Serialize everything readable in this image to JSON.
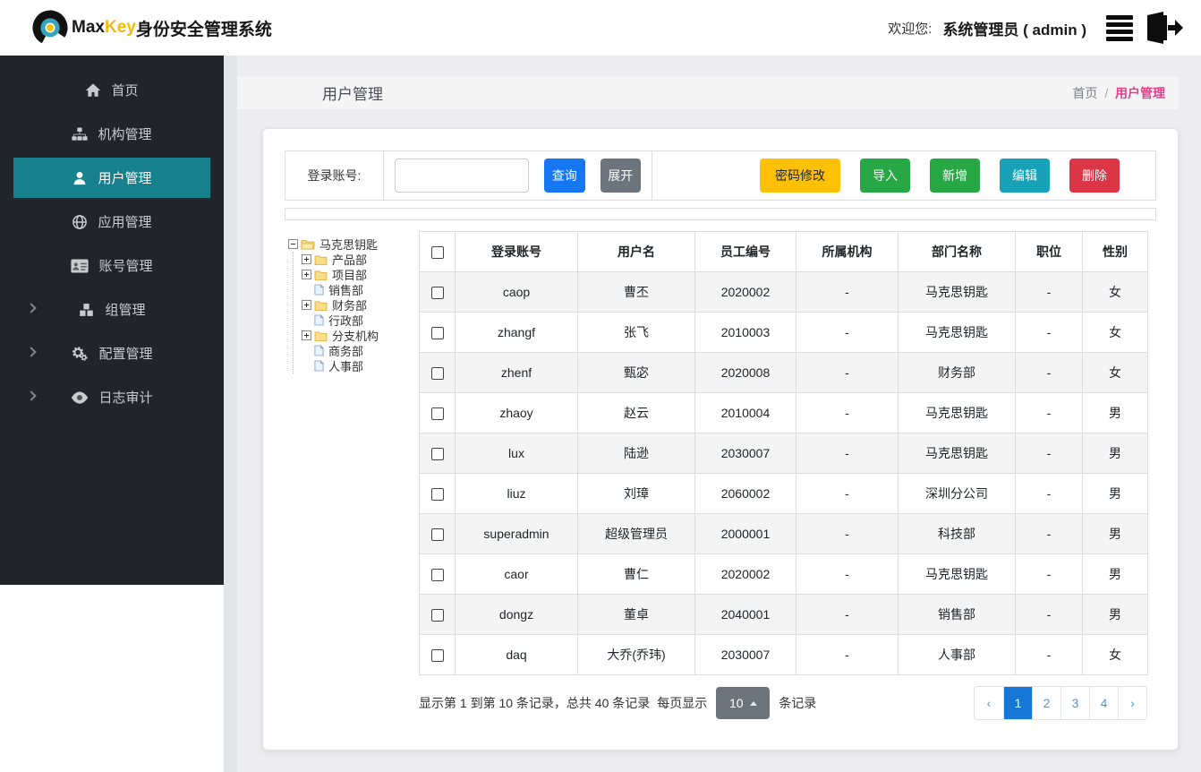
{
  "navbar": {
    "brand_max": "Max",
    "brand_key": "Key",
    "brand_suffix": "身份安全管理系统",
    "welcome_label": "欢迎您:",
    "user": "系统管理员 ( admin )"
  },
  "sidebar": {
    "items": [
      {
        "label": "首页",
        "icon": "home-icon",
        "active": false,
        "expandable": false
      },
      {
        "label": "机构管理",
        "icon": "sitemap-icon",
        "active": false,
        "expandable": false
      },
      {
        "label": "用户管理",
        "icon": "user-icon",
        "active": true,
        "expandable": false
      },
      {
        "label": "应用管理",
        "icon": "globe-icon",
        "active": false,
        "expandable": false
      },
      {
        "label": "账号管理",
        "icon": "id-card-icon",
        "active": false,
        "expandable": false
      },
      {
        "label": "组管理",
        "icon": "cubes-icon",
        "active": false,
        "expandable": true
      },
      {
        "label": "配置管理",
        "icon": "gears-icon",
        "active": false,
        "expandable": true
      },
      {
        "label": "日志审计",
        "icon": "eye-icon",
        "active": false,
        "expandable": true
      }
    ]
  },
  "page_header": {
    "title": "用户管理",
    "breadcrumb_home": "首页",
    "breadcrumb_sep": "/",
    "breadcrumb_current": "用户管理"
  },
  "toolbar": {
    "search_label": "登录账号:",
    "search_value": "",
    "query_label": "查询",
    "expand_label": "展开",
    "password_label": "密码修改",
    "import_label": "导入",
    "add_label": "新增",
    "edit_label": "编辑",
    "delete_label": "删除"
  },
  "tree": {
    "root": "马克思钥匙",
    "children": [
      {
        "label": "产品部",
        "type": "folder"
      },
      {
        "label": "项目部",
        "type": "folder"
      },
      {
        "label": "销售部",
        "type": "file"
      },
      {
        "label": "财务部",
        "type": "folder"
      },
      {
        "label": "行政部",
        "type": "file"
      },
      {
        "label": "分支机构",
        "type": "folder"
      },
      {
        "label": "商务部",
        "type": "file"
      },
      {
        "label": "人事部",
        "type": "file"
      }
    ]
  },
  "table": {
    "columns": [
      "登录账号",
      "用户名",
      "员工编号",
      "所属机构",
      "部门名称",
      "职位",
      "性别"
    ],
    "rows": [
      [
        "caop",
        "曹丕",
        "2020002",
        "-",
        "马克思钥匙",
        "-",
        "女"
      ],
      [
        "zhangf",
        "张飞",
        "2010003",
        "-",
        "马克思钥匙",
        "-",
        "女"
      ],
      [
        "zhenf",
        "甄宓",
        "2020008",
        "-",
        "财务部",
        "-",
        "女"
      ],
      [
        "zhaoy",
        "赵云",
        "2010004",
        "-",
        "马克思钥匙",
        "-",
        "男"
      ],
      [
        "lux",
        "陆逊",
        "2030007",
        "-",
        "马克思钥匙",
        "-",
        "男"
      ],
      [
        "liuz",
        "刘璋",
        "2060002",
        "-",
        "深圳分公司",
        "-",
        "男"
      ],
      [
        "superadmin",
        "超级管理员",
        "2000001",
        "-",
        "科技部",
        "-",
        "男"
      ],
      [
        "caor",
        "曹仁",
        "2020002",
        "-",
        "马克思钥匙",
        "-",
        "男"
      ],
      [
        "dongz",
        "董卓",
        "2040001",
        "-",
        "销售部",
        "-",
        "男"
      ],
      [
        "daq",
        "大乔(乔玮)",
        "2030007",
        "-",
        "人事部",
        "-",
        "女"
      ]
    ]
  },
  "pagination": {
    "summary": "显示第 1 到第 10 条记录，总共 40 条记录",
    "per_page_label": "每页显示",
    "page_size": "10",
    "records_suffix": "条记录",
    "prev": "‹",
    "next": "›",
    "pages": [
      "1",
      "2",
      "3",
      "4"
    ],
    "active_page": "1"
  },
  "colors": {
    "sidebar_bg": "#212529",
    "sidebar_active": "#17808d",
    "primary_blue": "#1677f3",
    "success_green": "#28a745",
    "info_teal": "#17a2b8",
    "warning_yellow": "#ffc107",
    "danger_red": "#dc3545",
    "secondary_gray": "#6c757d",
    "breadcrumb_pink": "#e83e8c",
    "pager_active_blue": "#1677d6"
  }
}
